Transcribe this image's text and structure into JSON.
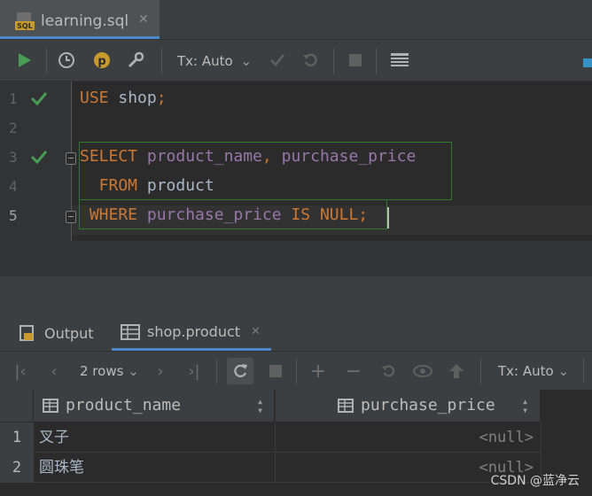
{
  "editor_tab": {
    "title": "learning.sql",
    "icon": "sql-file-icon"
  },
  "toolbar": {
    "tx_mode": "Tx: Auto"
  },
  "editor": {
    "line_numbers": [
      "1",
      "2",
      "3",
      "4",
      "5"
    ],
    "lines": [
      {
        "tokens": [
          {
            "t": "USE",
            "c": "kw"
          },
          {
            "t": " shop",
            "c": "pl"
          },
          {
            "t": ";",
            "c": "kw"
          }
        ]
      },
      {
        "tokens": []
      },
      {
        "tokens": [
          {
            "t": "SELECT",
            "c": "kw"
          },
          {
            "t": " product_name",
            "c": "id"
          },
          {
            "t": ", ",
            "c": "kw"
          },
          {
            "t": "purchase_price",
            "c": "id"
          }
        ]
      },
      {
        "tokens": [
          {
            "t": "  FROM",
            "c": "kw"
          },
          {
            "t": " product",
            "c": "pl"
          }
        ]
      },
      {
        "tokens": [
          {
            "t": " WHERE",
            "c": "kw"
          },
          {
            "t": " purchase_price",
            "c": "id"
          },
          {
            "t": " IS NULL",
            "c": "kw"
          },
          {
            "t": ";",
            "c": "kw"
          }
        ]
      }
    ]
  },
  "results": {
    "tabs": [
      {
        "label": "Output"
      },
      {
        "label": "shop.product"
      }
    ],
    "rows_label": "2 rows",
    "tx_mode": "Tx: Auto",
    "columns": [
      "product_name",
      "purchase_price"
    ],
    "row_numbers": [
      "1",
      "2"
    ],
    "rows": [
      [
        "叉子",
        "<null>"
      ],
      [
        "圆珠笔",
        "<null>"
      ]
    ]
  },
  "watermark": "CSDN @蓝净云",
  "colors": {
    "accent": "#4a88c7",
    "run_green": "#499c54",
    "keyword": "#cc7832",
    "identifier": "#9876aa"
  }
}
